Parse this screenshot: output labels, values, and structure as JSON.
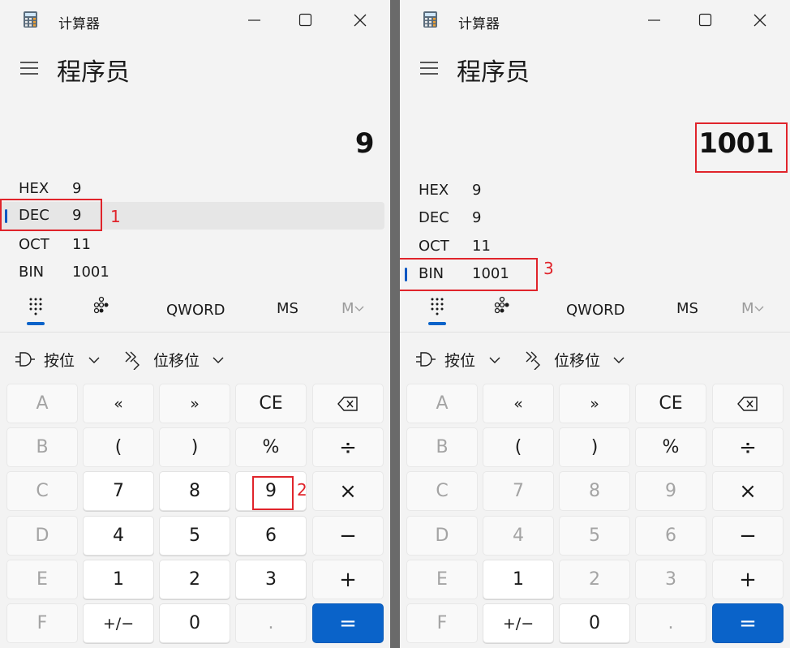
{
  "colors": {
    "accent": "#0a63c9",
    "annotation": "#e0242b",
    "window_bg": "#f3f3f3"
  },
  "left": {
    "title": "计算器",
    "mode": "程序员",
    "display": "9",
    "radix": [
      {
        "name": "HEX",
        "value": "9"
      },
      {
        "name": "DEC",
        "value": "9"
      },
      {
        "name": "OCT",
        "value": "11"
      },
      {
        "name": "BIN",
        "value": "1001"
      }
    ],
    "tabs": {
      "word": "QWORD",
      "ms": "MS",
      "mv": "M"
    },
    "dropdowns": {
      "bitwise": "按位",
      "bitshift": "位移位"
    },
    "keys": {
      "r0": [
        "A",
        "«",
        "»",
        "CE",
        "backspace"
      ],
      "r1": [
        "B",
        "(",
        ")",
        "%",
        "÷"
      ],
      "r2": [
        "C",
        "7",
        "8",
        "9",
        "×"
      ],
      "r3": [
        "D",
        "4",
        "5",
        "6",
        "−"
      ],
      "r4": [
        "E",
        "1",
        "2",
        "3",
        "+"
      ],
      "r5": [
        "F",
        "+/−",
        "0",
        ".",
        "="
      ]
    },
    "annotations": [
      "1",
      "2"
    ]
  },
  "right": {
    "title": "计算器",
    "mode": "程序员",
    "display": "1001",
    "radix": [
      {
        "name": "HEX",
        "value": "9"
      },
      {
        "name": "DEC",
        "value": "9"
      },
      {
        "name": "OCT",
        "value": "11"
      },
      {
        "name": "BIN",
        "value": "1001"
      }
    ],
    "tabs": {
      "word": "QWORD",
      "ms": "MS",
      "mv": "M"
    },
    "dropdowns": {
      "bitwise": "按位",
      "bitshift": "位移位"
    },
    "keys": {
      "r0": [
        "A",
        "«",
        "»",
        "CE",
        "backspace"
      ],
      "r1": [
        "B",
        "(",
        ")",
        "%",
        "÷"
      ],
      "r2": [
        "C",
        "7",
        "8",
        "9",
        "×"
      ],
      "r3": [
        "D",
        "4",
        "5",
        "6",
        "−"
      ],
      "r4": [
        "E",
        "1",
        "2",
        "3",
        "+"
      ],
      "r5": [
        "F",
        "+/−",
        "0",
        ".",
        "="
      ]
    },
    "annotations": [
      "3"
    ]
  }
}
